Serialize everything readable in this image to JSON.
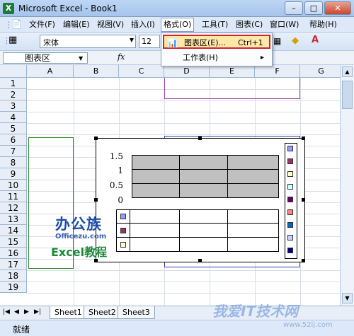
{
  "window": {
    "title": "Microsoft Excel - Book1",
    "btn_min": "–",
    "btn_max": "□",
    "btn_close": "✕"
  },
  "menu": {
    "items": [
      "文件(F)",
      "编辑(E)",
      "视图(V)",
      "插入(I)",
      "格式(O)",
      "工具(T)",
      "图表(C)",
      "窗口(W)",
      "帮助(H)"
    ],
    "right_min": "–",
    "right_restore": "▫",
    "right_close": "×"
  },
  "toolbar": {
    "font_name": "宋体",
    "font_size": "12"
  },
  "formula": {
    "name_box": "图表区",
    "fx": "fx"
  },
  "dropdown": {
    "item1_label": "图表区(E)...",
    "item1_shortcut": "Ctrl+1",
    "item2_label": "工作表(H)",
    "item2_arrow": "▸"
  },
  "grid": {
    "columns": [
      "A",
      "B",
      "C",
      "D",
      "E",
      "F",
      "G"
    ],
    "rows": [
      "1",
      "2",
      "3",
      "4",
      "5",
      "6",
      "7",
      "8",
      "9",
      "10",
      "11",
      "12",
      "13",
      "14",
      "15",
      "16",
      "17",
      "18",
      "19"
    ]
  },
  "chart": {
    "y_ticks": [
      "1.5",
      "1",
      "0.5",
      "0"
    ],
    "legend_colors": [
      "#9999ff",
      "#993366",
      "#ffffcc",
      "#ccffff",
      "#660066",
      "#ff8080",
      "#0066cc",
      "#ccccff",
      "#000080"
    ],
    "table_colors": [
      "#9999ff",
      "#993366",
      "#ffffcc"
    ]
  },
  "watermark": {
    "line1": "办公族",
    "line2": "Officezu.com",
    "line3": "Excel教程",
    "baidu": "我爱IT技术网",
    "baidu_url": "www.52ij.com"
  },
  "sheets": [
    "Sheet1",
    "Sheet2",
    "Sheet3"
  ],
  "status": {
    "text": "就绪"
  }
}
